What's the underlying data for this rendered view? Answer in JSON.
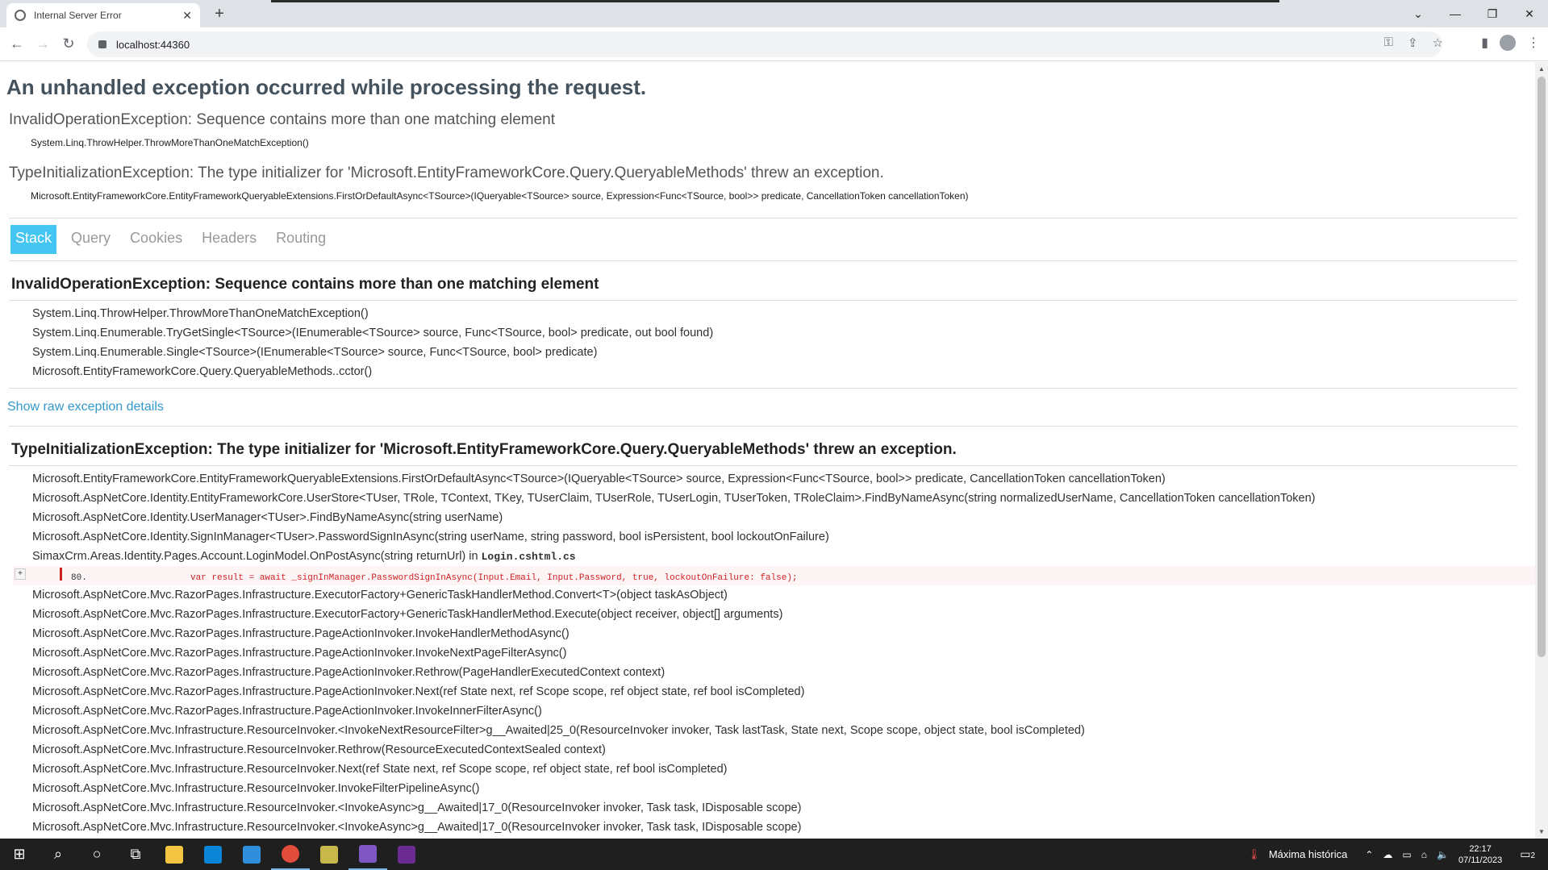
{
  "browser": {
    "tab_title": "Internal Server Error",
    "tab_close": "✕",
    "new_tab": "+",
    "url": "localhost:44360",
    "win_controls": [
      "⌄",
      "—",
      "❐",
      "✕"
    ]
  },
  "page": {
    "heading": "An unhandled exception occurred while processing the request.",
    "summary": [
      {
        "error": "InvalidOperationException: Sequence contains more than one matching element",
        "location": "System.Linq.ThrowHelper.ThrowMoreThanOneMatchException()"
      },
      {
        "error": "TypeInitializationException: The type initializer for 'Microsoft.EntityFrameworkCore.Query.QueryableMethods' threw an exception.",
        "location": "Microsoft.EntityFrameworkCore.EntityFrameworkQueryableExtensions.FirstOrDefaultAsync<TSource>(IQueryable<TSource> source, Expression<Func<TSource, bool>> predicate, CancellationToken cancellationToken)"
      }
    ],
    "tabs": [
      "Stack",
      "Query",
      "Cookies",
      "Headers",
      "Routing"
    ],
    "active_tab": "Stack",
    "exception1": {
      "title": "InvalidOperationException: Sequence contains more than one matching element",
      "frames": [
        "System.Linq.ThrowHelper.ThrowMoreThanOneMatchException()",
        "System.Linq.Enumerable.TryGetSingle<TSource>(IEnumerable<TSource> source, Func<TSource, bool> predicate, out bool found)",
        "System.Linq.Enumerable.Single<TSource>(IEnumerable<TSource> source, Func<TSource, bool> predicate)",
        "Microsoft.EntityFrameworkCore.Query.QueryableMethods..cctor()"
      ]
    },
    "raw_link": "Show raw exception details",
    "exception2": {
      "title": "TypeInitializationException: The type initializer for 'Microsoft.EntityFrameworkCore.Query.QueryableMethods' threw an exception.",
      "frames_before": [
        "Microsoft.EntityFrameworkCore.EntityFrameworkQueryableExtensions.FirstOrDefaultAsync<TSource>(IQueryable<TSource> source, Expression<Func<TSource, bool>> predicate, CancellationToken cancellationToken)",
        "Microsoft.AspNetCore.Identity.EntityFrameworkCore.UserStore<TUser, TRole, TContext, TKey, TUserClaim, TUserRole, TUserLogin, TUserToken, TRoleClaim>.FindByNameAsync(string normalizedUserName, CancellationToken cancellationToken)",
        "Microsoft.AspNetCore.Identity.UserManager<TUser>.FindByNameAsync(string userName)",
        "Microsoft.AspNetCore.Identity.SignInManager<TUser>.PasswordSignInAsync(string userName, string password, bool isPersistent, bool lockoutOnFailure)"
      ],
      "user_frame": "SimaxCrm.Areas.Identity.Pages.Account.LoginModel.OnPostAsync(string returnUrl) in ",
      "user_file": "Login.cshtml.cs",
      "code_expander": "+",
      "code_line_number": "80.",
      "code_line": "var result = await _signInManager.PasswordSignInAsync(Input.Email, Input.Password, true, lockoutOnFailure: false);",
      "frames_after": [
        "Microsoft.AspNetCore.Mvc.RazorPages.Infrastructure.ExecutorFactory+GenericTaskHandlerMethod.Convert<T>(object taskAsObject)",
        "Microsoft.AspNetCore.Mvc.RazorPages.Infrastructure.ExecutorFactory+GenericTaskHandlerMethod.Execute(object receiver, object[] arguments)",
        "Microsoft.AspNetCore.Mvc.RazorPages.Infrastructure.PageActionInvoker.InvokeHandlerMethodAsync()",
        "Microsoft.AspNetCore.Mvc.RazorPages.Infrastructure.PageActionInvoker.InvokeNextPageFilterAsync()",
        "Microsoft.AspNetCore.Mvc.RazorPages.Infrastructure.PageActionInvoker.Rethrow(PageHandlerExecutedContext context)",
        "Microsoft.AspNetCore.Mvc.RazorPages.Infrastructure.PageActionInvoker.Next(ref State next, ref Scope scope, ref object state, ref bool isCompleted)",
        "Microsoft.AspNetCore.Mvc.RazorPages.Infrastructure.PageActionInvoker.InvokeInnerFilterAsync()",
        "Microsoft.AspNetCore.Mvc.Infrastructure.ResourceInvoker.<InvokeNextResourceFilter>g__Awaited|25_0(ResourceInvoker invoker, Task lastTask, State next, Scope scope, object state, bool isCompleted)",
        "Microsoft.AspNetCore.Mvc.Infrastructure.ResourceInvoker.Rethrow(ResourceExecutedContextSealed context)",
        "Microsoft.AspNetCore.Mvc.Infrastructure.ResourceInvoker.Next(ref State next, ref Scope scope, ref object state, ref bool isCompleted)",
        "Microsoft.AspNetCore.Mvc.Infrastructure.ResourceInvoker.InvokeFilterPipelineAsync()",
        "Microsoft.AspNetCore.Mvc.Infrastructure.ResourceInvoker.<InvokeAsync>g__Awaited|17_0(ResourceInvoker invoker, Task task, IDisposable scope)",
        "Microsoft.AspNetCore.Mvc.Infrastructure.ResourceInvoker.<InvokeAsync>g__Awaited|17_0(ResourceInvoker invoker, Task task, IDisposable scope)"
      ]
    }
  },
  "taskbar": {
    "weather": "Máxima histórica",
    "time": "22:17",
    "date": "07/11/2023",
    "notifications": "2",
    "apps": [
      {
        "name": "explorer",
        "color": "#f4c542"
      },
      {
        "name": "store",
        "color": "#0a84d6"
      },
      {
        "name": "mail",
        "color": "#2f8fdc"
      },
      {
        "name": "chrome",
        "color": "#e24c3b"
      },
      {
        "name": "app-yellow",
        "color": "#c8b84a"
      },
      {
        "name": "visual-studio",
        "color": "#7e57c2"
      },
      {
        "name": "terminal",
        "color": "#6a2c91"
      }
    ]
  }
}
